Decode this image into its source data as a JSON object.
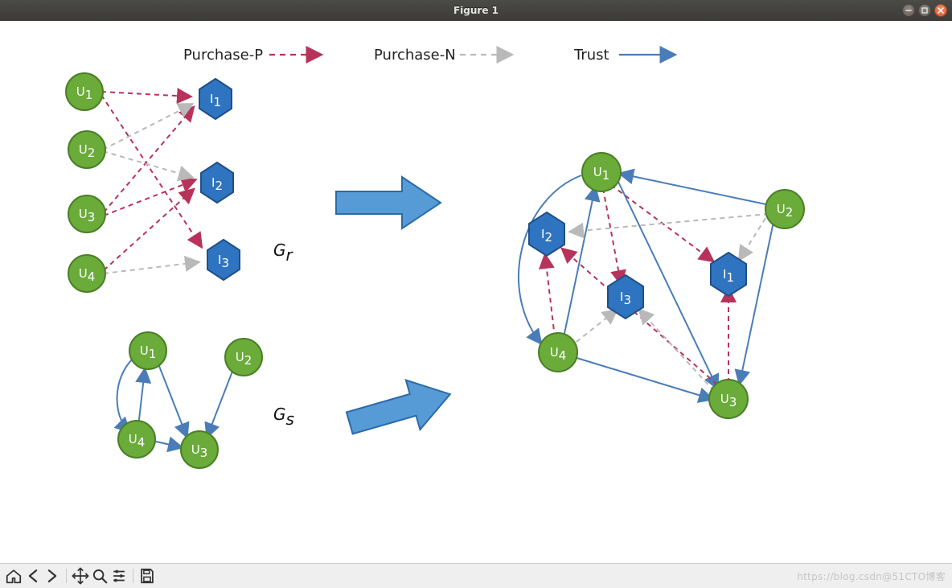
{
  "window": {
    "title": "Figure 1"
  },
  "watermark": "https://blog.csdn@51CTO博客",
  "legend": {
    "purchase_p": "Purchase-P",
    "purchase_n": "Purchase-N",
    "trust": "Trust"
  },
  "graph_labels": {
    "Gr": "G",
    "Gr_sub": "r",
    "Gs": "G",
    "Gs_sub": "s"
  },
  "colors": {
    "userFill": "#6aab3a",
    "userStroke": "#4a7f25",
    "itemFill": "#2f74c0",
    "itemStroke": "#204f86",
    "trustLine": "#4a7db7",
    "purchaseP": "#b7335b",
    "purchaseN": "#b9b9b9",
    "bigArrowFill": "#569bd5",
    "bigArrowStroke": "#2a6aa8"
  },
  "node_labels": {
    "U1": "U₁",
    "U2": "U₂",
    "U3": "U₃",
    "U4": "U₄",
    "I1": "I₁",
    "I2": "I₂",
    "I3": "I₃"
  },
  "left_rating_graph": {
    "users": [
      "U1",
      "U2",
      "U3",
      "U4"
    ],
    "items": [
      "I1",
      "I2",
      "I3"
    ],
    "edges_p": [
      [
        "U1",
        "I1"
      ],
      [
        "U1",
        "I3"
      ],
      [
        "U3",
        "I1"
      ],
      [
        "U3",
        "I2"
      ],
      [
        "U4",
        "I2"
      ]
    ],
    "edges_n": [
      [
        "U2",
        "I1"
      ],
      [
        "U2",
        "I2"
      ],
      [
        "U4",
        "I3"
      ]
    ]
  },
  "left_social_graph": {
    "nodes": [
      "U1",
      "U2",
      "U3",
      "U4"
    ],
    "trust_edges": [
      [
        "U1",
        "U4"
      ],
      [
        "U4",
        "U1"
      ],
      [
        "U1",
        "U3"
      ],
      [
        "U2",
        "U3"
      ],
      [
        "U4",
        "U3"
      ]
    ]
  },
  "right_graph": {
    "users": [
      "U1",
      "U2",
      "U3",
      "U4"
    ],
    "items": [
      "I1",
      "I2",
      "I3"
    ],
    "edges_p": [
      [
        "U1",
        "I1"
      ],
      [
        "U1",
        "I3"
      ],
      [
        "U3",
        "I1"
      ],
      [
        "U3",
        "I2"
      ],
      [
        "U4",
        "I2"
      ]
    ],
    "edges_n": [
      [
        "U2",
        "I1"
      ],
      [
        "U2",
        "I2"
      ],
      [
        "U4",
        "I3"
      ]
    ],
    "trust_edges": [
      [
        "U1",
        "U4"
      ],
      [
        "U4",
        "U1"
      ],
      [
        "U1",
        "U3"
      ],
      [
        "U2",
        "U3"
      ],
      [
        "U4",
        "U3"
      ]
    ]
  },
  "toolbar": {
    "home": "Home",
    "back": "Back",
    "forward": "Forward",
    "pan": "Pan",
    "zoom": "Zoom",
    "configure": "Configure subplots",
    "save": "Save"
  },
  "window_buttons": {
    "min": "Minimize",
    "max": "Maximize",
    "close": "Close"
  }
}
